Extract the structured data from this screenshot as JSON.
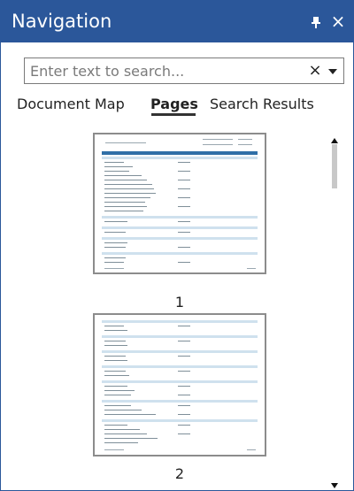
{
  "titlebar": {
    "title": "Navigation",
    "pin_icon": "pin-icon",
    "close_label": "×"
  },
  "search": {
    "placeholder": "Enter text to search...",
    "value": "",
    "clear_label": "×",
    "dropdown_icon": "chevron-down-icon"
  },
  "tabs": [
    {
      "label": "Document Map",
      "selected": false
    },
    {
      "label": "Pages",
      "selected": true
    },
    {
      "label": "Search Results",
      "selected": false
    }
  ],
  "pages": [
    {
      "number": "1"
    },
    {
      "number": "2"
    }
  ],
  "colors": {
    "accent": "#2b579a",
    "thumbnail_header": "#2f6fa7",
    "thumbnail_band": "#cfe1ee"
  }
}
